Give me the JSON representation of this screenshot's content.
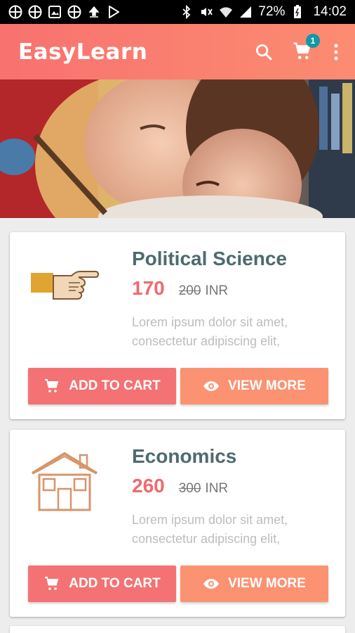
{
  "status_bar": {
    "battery": "72%",
    "time": "14:02",
    "icons": [
      "notification-grid-icon",
      "notification-grid-icon",
      "image-icon",
      "notification-grid-icon",
      "upload-icon",
      "play-store-icon",
      "bluetooth-icon",
      "mute-icon",
      "wifi-icon",
      "signal-icon",
      "battery-icon"
    ]
  },
  "appbar": {
    "title": "EasyLearn",
    "cart_count": "1",
    "icons": [
      "search-icon",
      "cart-icon",
      "more-vert-icon"
    ]
  },
  "colors": {
    "appbar_start": "#f8726f",
    "appbar_end": "#fb8c71",
    "title_text": "#4e6a6e",
    "price": "#ef6a6f",
    "add_to_cart": "#f47273",
    "view_more": "#fb9272",
    "badge": "#0f98a8"
  },
  "courses": [
    {
      "title": "Political Science",
      "price": "170",
      "old_price": "200",
      "currency": "INR",
      "description": "Lorem ipsum dolor sit amet, consectetur adipiscing elit,",
      "icon": "pointing-hand-icon",
      "add_label": "ADD TO CART",
      "view_label": "VIEW MORE"
    },
    {
      "title": "Economics",
      "price": "260",
      "old_price": "300",
      "currency": "INR",
      "description": "Lorem ipsum dolor sit amet, consectetur adipiscing elit,",
      "icon": "house-icon",
      "add_label": "ADD TO CART",
      "view_label": "VIEW MORE"
    }
  ]
}
